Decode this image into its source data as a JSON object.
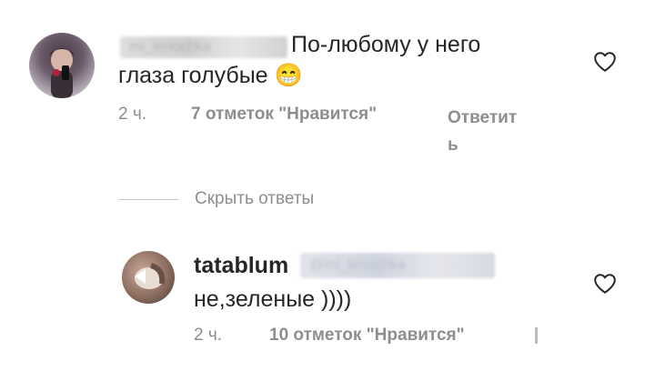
{
  "comment": {
    "username_redacted": "mi_lenochka",
    "text_line1": "По-любому у него",
    "text_line2": "глаза голубые 😁",
    "time": "2 ч.",
    "likes": "7 отметок \"Нравится\"",
    "reply_part1": "Ответит",
    "reply_part2": "ь"
  },
  "hide_replies": "Скрыть ответы",
  "reply": {
    "username": "tatablum",
    "mention_redacted": "@mi_lenochka",
    "text": "не,зеленые ))))",
    "time": "2 ч.",
    "likes": "10 отметок \"Нравится\""
  },
  "icons": {
    "like": "heart-outline-icon"
  }
}
